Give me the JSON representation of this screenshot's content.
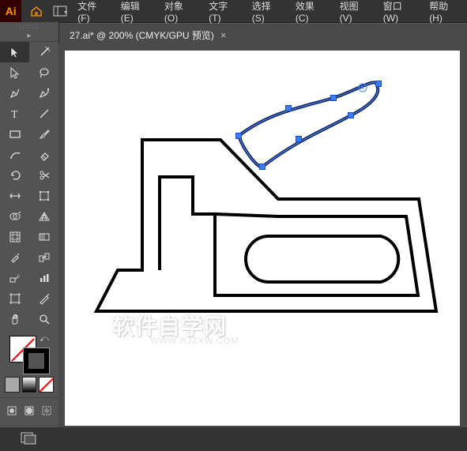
{
  "app": {
    "logo": "Ai"
  },
  "menu": {
    "file": "文件(F)",
    "edit": "编辑(E)",
    "object": "对象(O)",
    "type": "文字(T)",
    "select": "选择(S)",
    "effect": "效果(C)",
    "view": "视图(V)",
    "window": "窗口(W)",
    "help": "帮助(H)"
  },
  "tab": {
    "label": "27.ai* @ 200% (CMYK/GPU 预览)",
    "close": "×"
  },
  "watermark": {
    "main": "软件自学网",
    "sub": "WWW.RJZXW.COM"
  },
  "colors": {
    "panel": "#535353",
    "panel_dark": "#333333",
    "accent": "#ff9a00",
    "selection": "#3b7cff"
  }
}
